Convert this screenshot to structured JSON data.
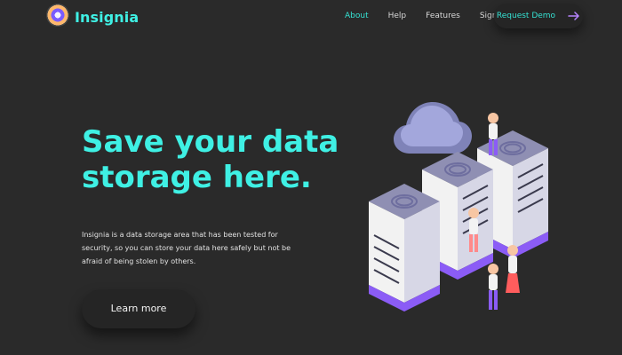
{
  "brand": {
    "name": "Insignia",
    "logo_icon": "insignia-logo-icon"
  },
  "nav": {
    "items": [
      {
        "label": "About",
        "active": true
      },
      {
        "label": "Help",
        "active": false
      },
      {
        "label": "Features",
        "active": false
      },
      {
        "label": "Signup",
        "active": false
      }
    ],
    "cta_label": "Request Demo",
    "cta_icon": "arrow-right-icon"
  },
  "hero": {
    "title": "Save your data storage here.",
    "description": "Insignia is a data storage area that has been tested for security, so you can store your data here safely but not be afraid of being stolen by others.",
    "button_label": "Learn more"
  },
  "illustration": {
    "icon": "server-racks-cloud-illustration",
    "colors": {
      "cloud": "#7f83b8",
      "server_top": "#8f8fb3",
      "server_side": "#f2f2f2",
      "accent": "#8b5cf6"
    }
  },
  "colors": {
    "background": "#2a2a2a",
    "accent": "#3ff0e4",
    "cta_arrow": "#b784ff"
  }
}
